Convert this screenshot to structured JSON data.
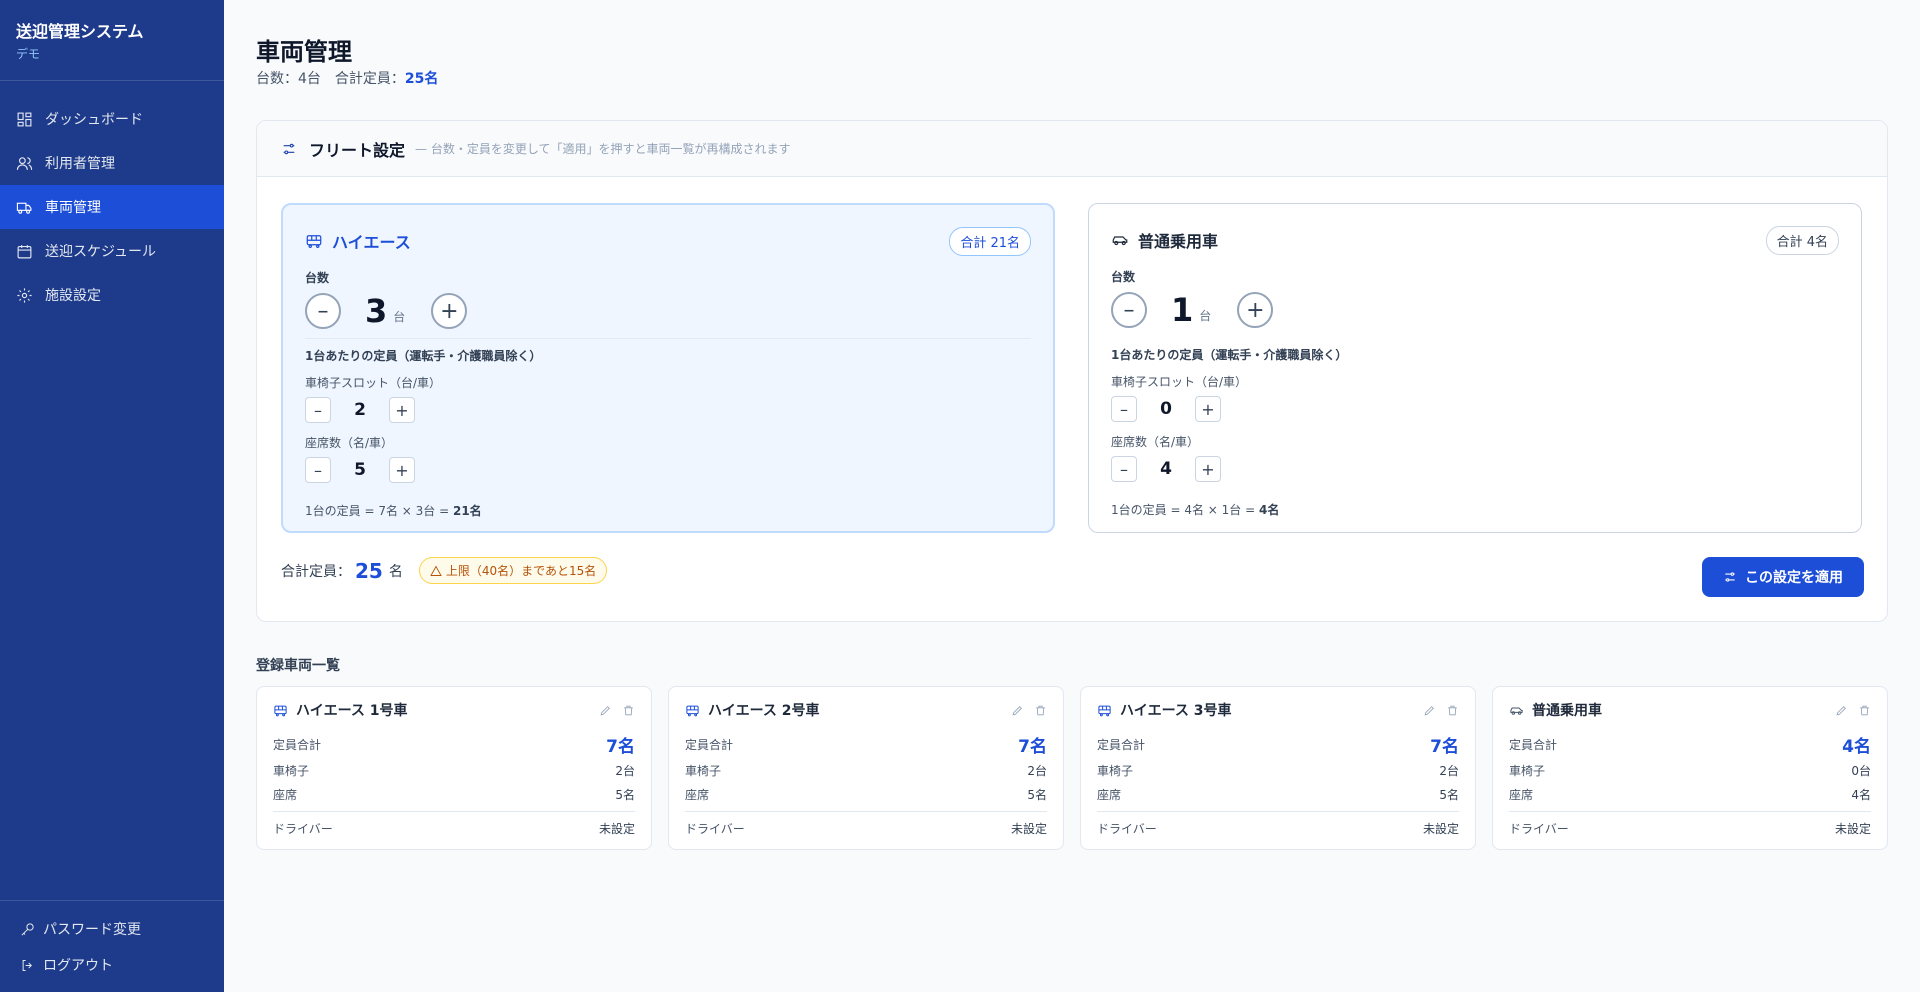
{
  "app": {
    "title": "送迎管理システム",
    "subtitle": "デモ"
  },
  "nav": [
    {
      "label": "ダッシュボード",
      "icon": "dashboard-icon"
    },
    {
      "label": "利用者管理",
      "icon": "users-icon"
    },
    {
      "label": "車両管理",
      "icon": "truck-icon",
      "active": true
    },
    {
      "label": "送迎スケジュール",
      "icon": "calendar-icon"
    },
    {
      "label": "施設設定",
      "icon": "gear-icon"
    }
  ],
  "side_bottom": {
    "password": "パスワード変更",
    "logout": "ログアウト"
  },
  "page": {
    "title": "車両管理",
    "sub_prefix": "台数：4台　合計定員：",
    "sub_total": "25名"
  },
  "fleet": {
    "title": "フリート設定",
    "desc": "— 台数・定員を変更して「適用」を押すと車両一覧が再構成されます",
    "count_label": "台数",
    "unit_count": "台",
    "capacity_label": "1台あたりの定員（運転手・介護職員除く）",
    "wheelchair_label": "車椅子スロット（台/車）",
    "seats_label": "座席数（名/車）",
    "cards": [
      {
        "name": "ハイエース",
        "pill": "合計 21名",
        "count": "3",
        "wheelchair": "2",
        "seats": "5",
        "formula_prefix": "1台の定員 = 7名 × 3台 = ",
        "formula_total": "21名"
      },
      {
        "name": "普通乗用車",
        "pill": "合計 4名",
        "count": "1",
        "wheelchair": "0",
        "seats": "4",
        "formula_prefix": "1台の定員 = 4名 × 1台 = ",
        "formula_total": "4名"
      }
    ],
    "total_label": "合計定員：",
    "total_value": "25",
    "total_unit": "名",
    "warning": "上限（40名）まであと15名",
    "apply_label": "この設定を適用"
  },
  "list": {
    "title": "登録車両一覧",
    "cap_label": "定員合計",
    "wheelchair_label": "車椅子",
    "seats_label": "座席",
    "driver_label": "ドライバー",
    "items": [
      {
        "name": "ハイエース 1号車",
        "cap": "7名",
        "wheelchair": "2台",
        "seats": "5名",
        "driver": "未設定"
      },
      {
        "name": "ハイエース 2号車",
        "cap": "7名",
        "wheelchair": "2台",
        "seats": "5名",
        "driver": "未設定"
      },
      {
        "name": "ハイエース 3号車",
        "cap": "7名",
        "wheelchair": "2台",
        "seats": "5名",
        "driver": "未設定"
      },
      {
        "name": "普通乗用車",
        "cap": "4名",
        "wheelchair": "0台",
        "seats": "4名",
        "driver": "未設定"
      }
    ]
  },
  "colors": {
    "sidebar": "#1e3a8a",
    "accent": "#1d4ed8",
    "warning": "#b45309"
  }
}
